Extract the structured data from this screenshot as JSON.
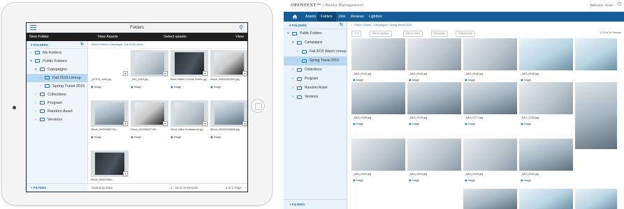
{
  "tablet": {
    "top_title": "Folders",
    "action_bar": {
      "new_folder": "New Folder",
      "new_assets": "New Assets",
      "select_assets": "Select assets",
      "view": "View"
    },
    "sidebar_header": "FOLDERS",
    "tree": [
      {
        "label": "My Folders",
        "level": 0
      },
      {
        "label": "Public Folders",
        "level": 0
      },
      {
        "label": "Campaigns",
        "level": 1
      },
      {
        "label": "Fall 2015 Lineup",
        "level": 2,
        "selected": true
      },
      {
        "label": "Spring Travel 2015",
        "level": 2
      },
      {
        "label": "Collections",
        "level": 1
      },
      {
        "label": "Program",
        "level": 1
      },
      {
        "label": "Random Asset",
        "level": 1
      },
      {
        "label": "Versions",
        "level": 1
      }
    ],
    "filters_label": "FILTERS",
    "breadcrumb": "Public Folders  ›  Campaigns  ›  Fall 2015 Lineup",
    "tiles": [
      {
        "name": "_DTS70_1469.jpg",
        "type": "Image",
        "photo": "blank"
      },
      {
        "name": "_IMG_0418.jpg",
        "type": "Image",
        "photo": "a"
      },
      {
        "name": "Black Tablet G Home Screen.jpg",
        "type": "Image",
        "photo": "d"
      },
      {
        "name": "iStock_000015003993.jpg",
        "type": "Image",
        "photo": "c"
      },
      {
        "name": "iStock_000009887784...",
        "type": "Image",
        "photo": "b"
      },
      {
        "name": "iStock_000006207765...",
        "type": "Image",
        "photo": "c"
      },
      {
        "name": "iStock Office Professional.jpg",
        "type": "Image",
        "photo": "a"
      },
      {
        "name": "iStock_000016058895.jpg",
        "type": "Image",
        "photo": "b"
      },
      {
        "name": "iStock_000013664...",
        "type": "Image",
        "photo": "d"
      }
    ],
    "footer": {
      "sorted": "Sorted by Date",
      "count": "1 - 16 of 16 Results",
      "page": "1 of 1 Page"
    }
  },
  "desktop": {
    "brand": "OPENTEXT",
    "product": "Media Management",
    "user": "Welcome, Victor",
    "nav_tabs": [
      {
        "label": "Assets",
        "active": false
      },
      {
        "label": "Folders",
        "active": true
      },
      {
        "label": "Jobs",
        "active": false
      },
      {
        "label": "Reviews",
        "active": false
      },
      {
        "label": "Lightbox",
        "active": false
      }
    ],
    "sidebar_header": "FOLDERS",
    "tree": [
      {
        "label": "Public Folders",
        "level": 0
      },
      {
        "label": "Campaigns",
        "level": 1
      },
      {
        "label": "Fall 2015 Watch Lineup",
        "level": 2
      },
      {
        "label": "Spring Travel 2015",
        "level": 2,
        "selected": true
      },
      {
        "label": "Collections",
        "level": 1
      },
      {
        "label": "Program",
        "level": 1
      },
      {
        "label": "Random Asset",
        "level": 1
      },
      {
        "label": "Versions",
        "level": 1
      }
    ],
    "filters_label": "FILTERS",
    "breadcrumb": "Public Folders  ›  Campaigns  ›  Spring Travel 2015",
    "toolbar": [
      "Add to lightbox",
      "Add to folder",
      "Subscribe",
      "Unsubscribe"
    ],
    "results": "1-20 of 30 Results",
    "tiles": [
      {
        "name": "_IMG_0140.jpg",
        "type": "Image",
        "photo": "a"
      },
      {
        "name": "_IMG_0145.jpg",
        "type": "Image",
        "photo": "a"
      },
      {
        "name": "_IMG_0146.jpg",
        "type": "Image",
        "photo": "a"
      },
      {
        "name": "_IMG_0158.jpg",
        "type": "Image",
        "photo": "e"
      },
      {
        "name": "_IMG_0159.jpg",
        "type": "Image",
        "photo": "b"
      },
      {
        "name": "_IMG_0176.jpg",
        "type": "Image",
        "photo": "b"
      },
      {
        "name": "_IMG_0177.jpg",
        "type": "Image",
        "photo": "b"
      },
      {
        "name": "_IMG_0233.jpg",
        "type": "Image",
        "photo": "a"
      },
      {
        "name": "_IMG_0419.jpg",
        "type": "Image",
        "photo": "a"
      },
      {
        "name": "_IMG_0423.jpg",
        "type": "Image",
        "photo": "a"
      },
      {
        "name": "_IMG_0425.jpg",
        "type": "Image",
        "photo": "a"
      },
      {
        "name": "_IMG_0182.jpg",
        "type": "Image",
        "photo": "b"
      }
    ]
  }
}
